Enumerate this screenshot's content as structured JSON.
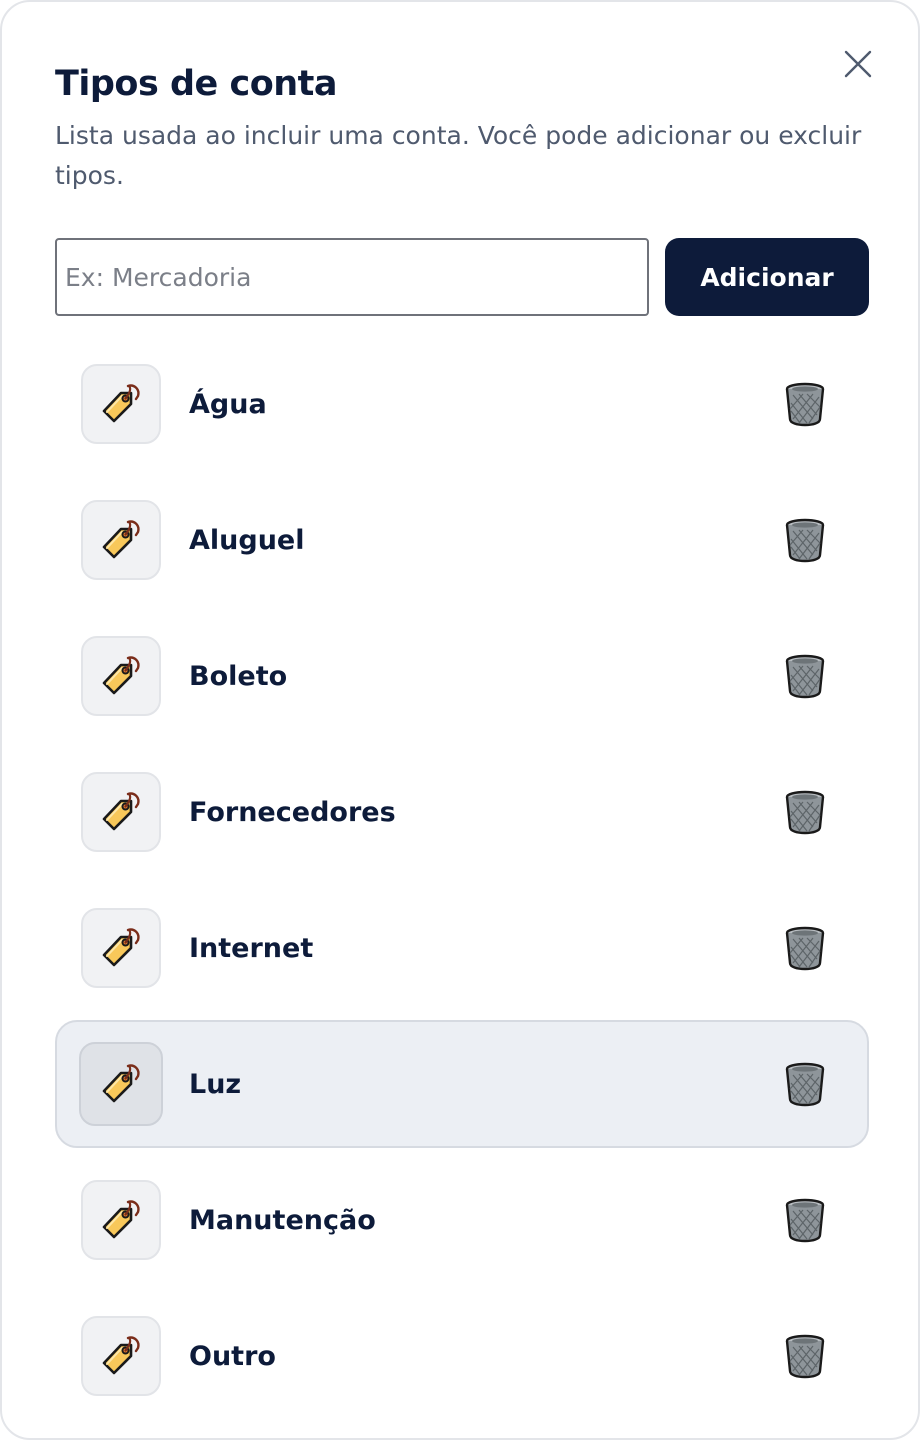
{
  "dialog": {
    "title": "Tipos de conta",
    "subtitle": "Lista usada ao incluir uma conta. Você pode adicionar ou excluir tipos.",
    "close_icon": "close-icon"
  },
  "add_form": {
    "placeholder": "Ex: Mercadoria",
    "value": "",
    "button_label": "Adicionar"
  },
  "types": [
    {
      "label": "Água",
      "icon": "tag-icon"
    },
    {
      "label": "Aluguel",
      "icon": "tag-icon"
    },
    {
      "label": "Boleto",
      "icon": "tag-icon"
    },
    {
      "label": "Fornecedores",
      "icon": "tag-icon"
    },
    {
      "label": "Internet",
      "icon": "tag-icon"
    },
    {
      "label": "Luz",
      "icon": "tag-icon",
      "highlighted": true
    },
    {
      "label": "Manutenção",
      "icon": "tag-icon"
    },
    {
      "label": "Outro",
      "icon": "tag-icon"
    }
  ],
  "colors": {
    "primary": "#0d1b3a",
    "muted_text": "#4f5a6e",
    "highlight_bg": "#eceff4",
    "tag_fill": "#f8c85a",
    "trash_fill": "#8e959a"
  }
}
